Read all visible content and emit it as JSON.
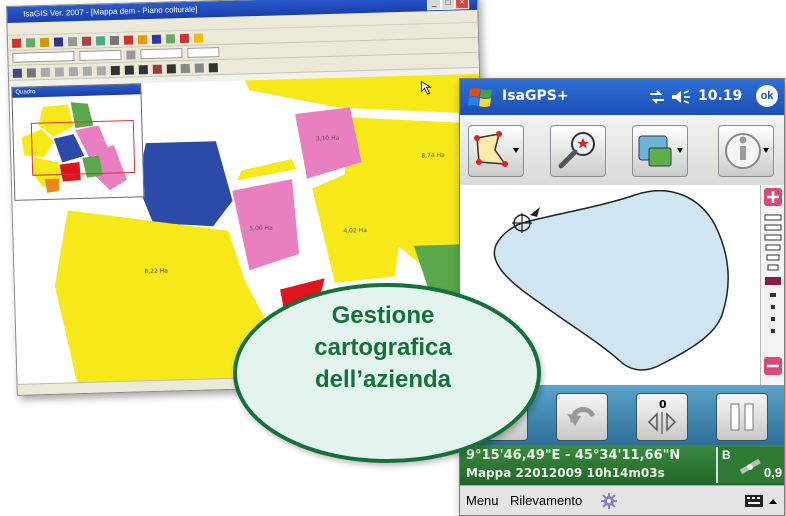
{
  "desktop": {
    "window_title": "IsaGIS Ver. 2007 - [Mappa dem - Piano colturale]",
    "minimap_title": "Quadro",
    "parcels": [
      {
        "label": "3,10 Ha",
        "color": "#e97fc0"
      },
      {
        "label": "5,00 Ha",
        "color": "#e97fc0"
      },
      {
        "label": "4,02 Ha",
        "color": "#f7e81a"
      },
      {
        "label": "8,74 Ha",
        "color": "#f7e81a"
      },
      {
        "label": "8,22 Ha",
        "color": "#f7e81a"
      }
    ]
  },
  "pocket_pc": {
    "app_title": "IsaGPS+",
    "clock": "10.19",
    "ok_label": "ok",
    "coords": "9°15'46,49\"E - 45°34'11,66\"N",
    "map_name": "Mappa 22012009 10h14m03s",
    "gps_letter": "B",
    "gps_value": "0,9",
    "menu_label": "Menu",
    "rilevamento_label": "Rilevamento"
  },
  "badge": {
    "line1": "Gestione",
    "line2": "cartografica",
    "line3": "dell’azienda"
  },
  "colors": {
    "desktop_titlebar": "#2a5bd0",
    "ppc_titlebar": "#1b4fb4",
    "status_green": "#2f7a33",
    "badge_green": "#16703a",
    "badge_fill": "#e3f4ee",
    "parcel_yellow": "#f7e81a",
    "parcel_pink": "#e97fc0",
    "parcel_blue": "#2c4aa8",
    "parcel_red": "#e0141c"
  }
}
